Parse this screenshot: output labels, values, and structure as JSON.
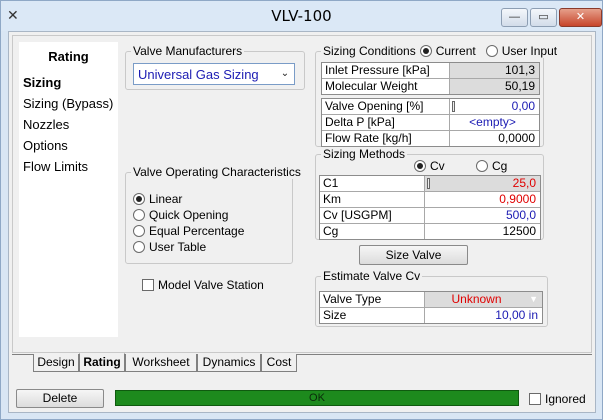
{
  "window": {
    "title": "VLV-100",
    "icon": "valve-icon",
    "minimize": "—",
    "maximize": "▭",
    "close": "✕"
  },
  "nav": {
    "heading": "Rating",
    "items": [
      "Sizing",
      "Sizing (Bypass)",
      "Nozzles",
      "Options",
      "Flow Limits"
    ],
    "active": "Sizing"
  },
  "manufacturers": {
    "legend": "Valve Manufacturers",
    "selected": "Universal Gas Sizing"
  },
  "characteristics": {
    "legend": "Valve Operating Characteristics",
    "options": [
      "Linear",
      "Quick Opening",
      "Equal Percentage",
      "User Table"
    ],
    "selected": "Linear"
  },
  "model_valve_station": {
    "label": "Model Valve Station",
    "checked": false
  },
  "sizing_conditions": {
    "legend": "Sizing Conditions",
    "mode_current": "Current",
    "mode_user": "User Input",
    "selected_mode": "Current",
    "rows1": [
      {
        "label": "Inlet Pressure [kPa]",
        "value": "101,3"
      },
      {
        "label": "Molecular Weight",
        "value": "50,19"
      }
    ],
    "rows2": [
      {
        "label": "Valve Opening [%]",
        "value": "0,00"
      },
      {
        "label": "Delta P [kPa]",
        "value": "<empty>"
      },
      {
        "label": "Flow Rate [kg/h]",
        "value": "0,0000"
      }
    ]
  },
  "sizing_methods": {
    "legend": "Sizing Methods",
    "opt_cv": "Cv",
    "opt_cg": "Cg",
    "selected": "Cv",
    "rows": [
      {
        "label": "C1",
        "value": "25,0"
      },
      {
        "label": "Km",
        "value": "0,9000"
      },
      {
        "label": "Cv [USGPM]",
        "value": "500,0"
      },
      {
        "label": "Cg",
        "value": "12500"
      }
    ]
  },
  "size_valve_button": "Size Valve",
  "estimate": {
    "legend": "Estimate Valve Cv",
    "rows": [
      {
        "label": "Valve Type",
        "value": "Unknown"
      },
      {
        "label": "Size",
        "value": "10,00 in"
      }
    ]
  },
  "tabs": [
    "Design",
    "Rating",
    "Worksheet",
    "Dynamics",
    "Cost"
  ],
  "active_tab": "Rating",
  "footer": {
    "delete": "Delete",
    "status": "OK",
    "ignored": "Ignored",
    "ignored_checked": false
  },
  "colors": {
    "status_ok": "#1d8a1d",
    "calculated_blue": "#1b1bb3",
    "specified_red": "#e00000"
  }
}
